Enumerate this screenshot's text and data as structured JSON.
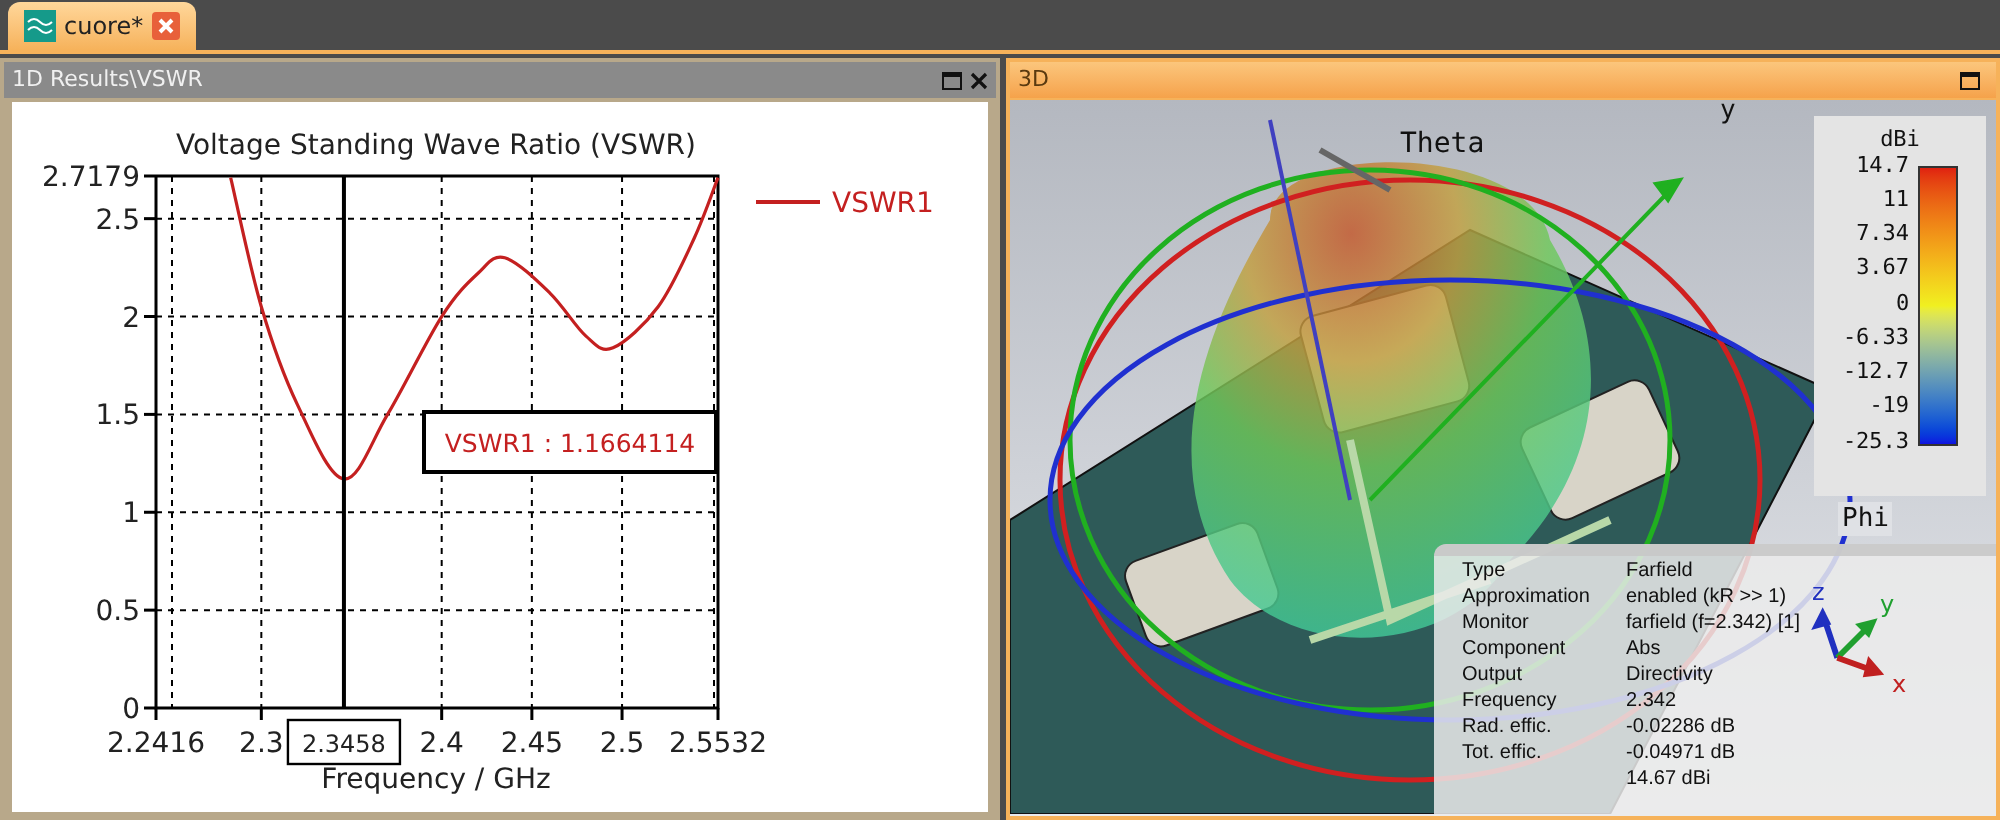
{
  "tabs": [
    {
      "label": "cuore*",
      "selected": true
    }
  ],
  "panels": [
    {
      "title": "1D Results\\VSWR",
      "active": false
    },
    {
      "title": "3D",
      "active": true
    }
  ],
  "chart": {
    "chart_data": {
      "type": "line",
      "title": "Voltage Standing Wave Ratio (VSWR)",
      "xlabel": "Frequency / GHz",
      "xlim": [
        2.2416,
        2.5532
      ],
      "ylim": [
        0,
        2.7179
      ],
      "xticks": [
        2.2416,
        2.3,
        2.4,
        2.45,
        2.5,
        2.5532
      ],
      "yticks": [
        0,
        0.5,
        1,
        1.5,
        2,
        2.5,
        2.7179
      ],
      "x": [
        2.283,
        2.3,
        2.32,
        2.3458,
        2.37,
        2.4,
        2.42,
        2.435,
        2.46,
        2.48,
        2.495,
        2.52,
        2.54,
        2.5532
      ],
      "series": [
        {
          "name": "VSWR1",
          "color": "#c42020",
          "values": [
            2.71,
            2.05,
            1.55,
            1.17,
            1.5,
            2.0,
            2.22,
            2.3,
            2.12,
            1.9,
            1.84,
            2.05,
            2.4,
            2.71
          ]
        }
      ],
      "grid": true,
      "ref_lines": [
        {
          "axis": "x",
          "value": 2.3458,
          "label": "2.3458"
        }
      ],
      "annotations": [
        "VSWR1 : 1.1664114"
      ]
    }
  },
  "view3d": {
    "labels": {
      "theta": "Theta",
      "phi": "Phi",
      "y_axis": "y"
    },
    "legend": {
      "unit": "dBi",
      "ticks": [
        "14.7",
        "11",
        "7.34",
        "3.67",
        "0",
        "-6.33",
        "-12.7",
        "-19",
        "-25.3"
      ]
    },
    "info": [
      {
        "label": "Type",
        "value": "Farfield"
      },
      {
        "label": "Approximation",
        "value": "enabled (kR >> 1)"
      },
      {
        "label": "Monitor",
        "value": "farfield (f=2.342) [1]"
      },
      {
        "label": "Component",
        "value": "Abs"
      },
      {
        "label": "Output",
        "value": "Directivity"
      },
      {
        "label": "Frequency",
        "value": "2.342"
      },
      {
        "label": "Rad. effic.",
        "value": "-0.02286 dB"
      },
      {
        "label": "Tot. effic.",
        "value": "-0.04971 dB"
      },
      {
        "value": "14.67 dBi"
      }
    ],
    "triad": {
      "x": "x",
      "y": "y",
      "z": "z"
    }
  }
}
